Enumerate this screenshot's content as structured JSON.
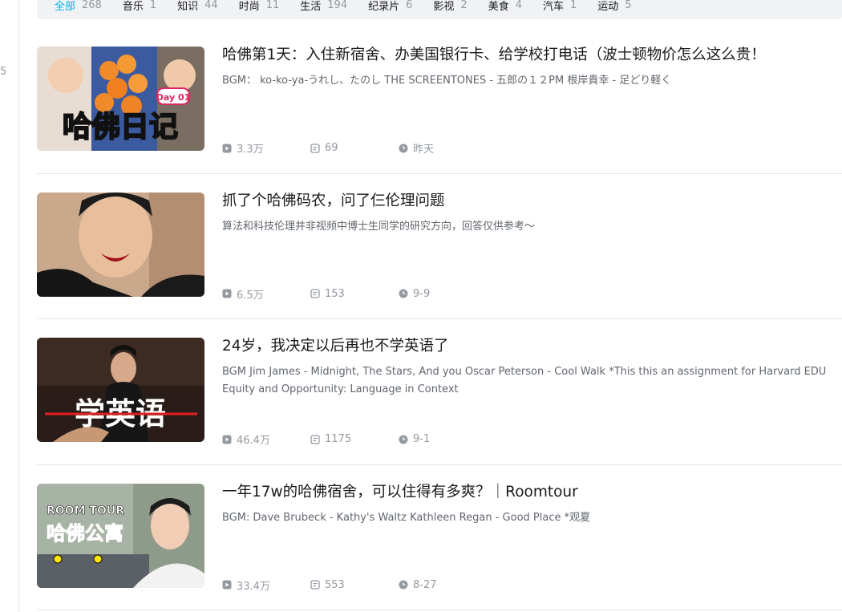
{
  "left_rail": {
    "edge_text": "5"
  },
  "filters": [
    {
      "label": "全部",
      "count": "268",
      "active": true
    },
    {
      "label": "音乐",
      "count": "1"
    },
    {
      "label": "知识",
      "count": "44"
    },
    {
      "label": "时尚",
      "count": "11"
    },
    {
      "label": "生活",
      "count": "194"
    },
    {
      "label": "纪录片",
      "count": "6"
    },
    {
      "label": "影视",
      "count": "2"
    },
    {
      "label": "美食",
      "count": "4"
    },
    {
      "label": "汽车",
      "count": "1"
    },
    {
      "label": "运动",
      "count": "5"
    }
  ],
  "videos": [
    {
      "title": "哈佛第1天：入住新宿舍、办美国银行卡、给学校打电话（波士顿物价怎么这么贵！",
      "desc": "BGM： ko-ko-ya-うれし、たのし THE SCREENTONES - 五郎の１２PM 根岸貴幸 - 足どり軽く",
      "views": "3.3万",
      "danmaku": "69",
      "date": "昨天",
      "thumb_text": "哈佛日记",
      "thumb_badge": "Day 01"
    },
    {
      "title": "抓了个哈佛码农，问了仨伦理问题",
      "desc": "算法和科技伦理并非视频中博士生同学的研究方向，回答仅供参考～",
      "views": "6.5万",
      "danmaku": "153",
      "date": "9-9"
    },
    {
      "title": "24岁，我决定以后再也不学英语了",
      "desc": "BGM Jim James - Midnight, The Stars, And you Oscar Peterson - Cool Walk   *This this an assignment for Harvard EDU Equity and Opportunity: Language in Context",
      "views": "46.4万",
      "danmaku": "1175",
      "date": "9-1",
      "thumb_text": "学英语"
    },
    {
      "title": "一年17w的哈佛宿舍，可以住得有多爽？｜Roomtour",
      "desc": "BGM: Dave Brubeck - Kathy's Waltz Kathleen Regan - Good Place *观夏",
      "views": "33.4万",
      "danmaku": "553",
      "date": "8-27",
      "thumb_text": "哈佛公寓",
      "thumb_badge": "ROOM TOUR"
    }
  ],
  "colors": {
    "accent": "#00aeec",
    "muted": "#9499a0",
    "divider": "#e3e5e7"
  },
  "icons": {
    "views": "play-icon",
    "danmaku": "danmaku-icon",
    "date": "clock-icon"
  }
}
